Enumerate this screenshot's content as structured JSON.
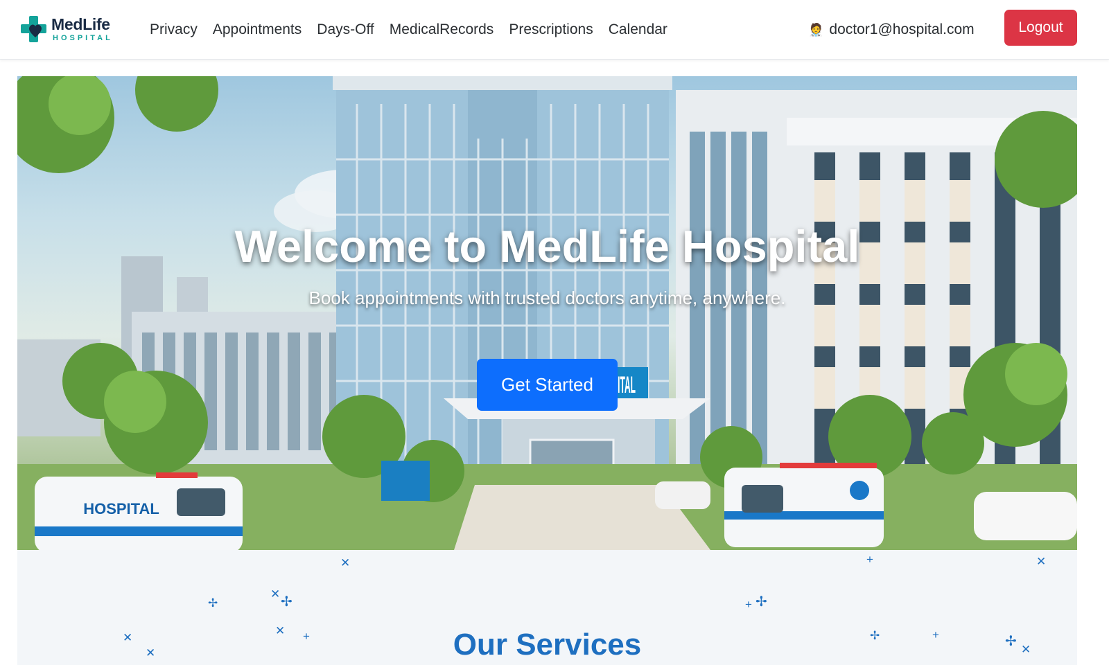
{
  "brand": {
    "name": "MedLife",
    "subtitle": "HOSPITAL"
  },
  "nav": {
    "links": [
      {
        "label": "Privacy"
      },
      {
        "label": "Appointments"
      },
      {
        "label": "Days-Off"
      },
      {
        "label": "MedicalRecords"
      },
      {
        "label": "Prescriptions"
      },
      {
        "label": "Calendar"
      }
    ],
    "user_icon": "🧑‍⚕️",
    "user_email": "doctor1@hospital.com",
    "logout_label": "Logout"
  },
  "hero": {
    "title": "Welcome to MedLife Hospital",
    "subtitle": "Book appointments with trusted doctors anytime, anywhere.",
    "cta_label": "Get Started",
    "building_sign": "HOSPITAL",
    "ambulance_label": "HOSPITAL"
  },
  "services": {
    "title": "Our Services"
  },
  "colors": {
    "primary": "#0d6efd",
    "danger": "#dc3545",
    "brand_dark": "#1a2b44",
    "brand_teal": "#14a39a",
    "services_title": "#1e6fc0"
  }
}
